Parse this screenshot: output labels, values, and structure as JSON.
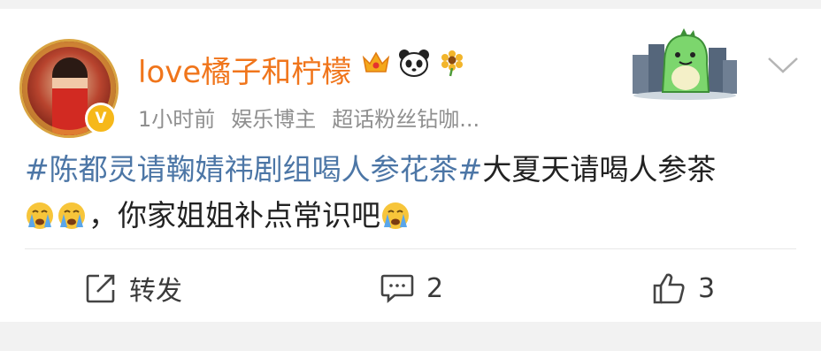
{
  "post": {
    "username": "love橘子和柠檬",
    "badges": [
      "crown-icon",
      "panda-icon",
      "sunflower-icon"
    ],
    "time": "1小时前",
    "role": "娱乐博主",
    "fan_tag": "超话粉丝钻咖...",
    "topic": "#陈都灵请鞠婧祎剧组喝人参花茶#",
    "text_after_topic": "大夏天请喝人参茶",
    "text_line2": "，你家姐姐补点常识吧",
    "verified_mark": "V"
  },
  "actions": {
    "repost_label": "转发",
    "comment_count": "2",
    "like_count": "3"
  },
  "colors": {
    "username": "#f0751b",
    "topic": "#4c76a6",
    "meta": "#8f8f8f"
  }
}
